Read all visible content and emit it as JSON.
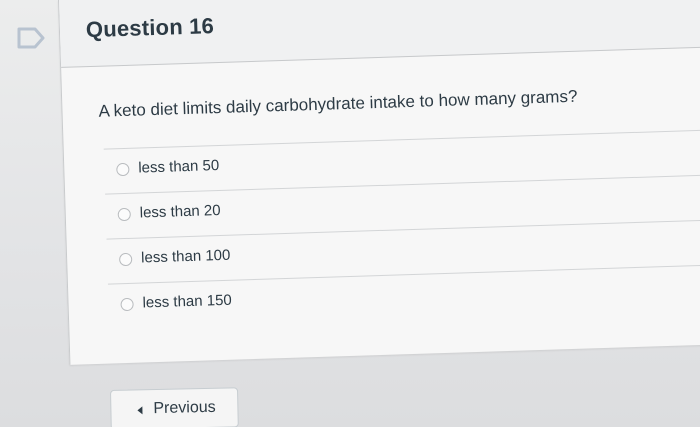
{
  "question": {
    "title": "Question 16",
    "text": "A keto diet limits daily carbohydrate intake to how many grams?",
    "answers": [
      {
        "label": "less than 50",
        "selected": false
      },
      {
        "label": "less than 20",
        "selected": false
      },
      {
        "label": "less than 100",
        "selected": false
      },
      {
        "label": "less than 150",
        "selected": false
      }
    ]
  },
  "navigation": {
    "previous_label": "Previous"
  },
  "icons": {
    "flag": "flag-icon",
    "radio": "radio-icon",
    "previous": "chevron-left-icon"
  },
  "colors": {
    "text": "#2d3b45",
    "flag": "#b8c3d0",
    "border": "#c7c9cb"
  }
}
